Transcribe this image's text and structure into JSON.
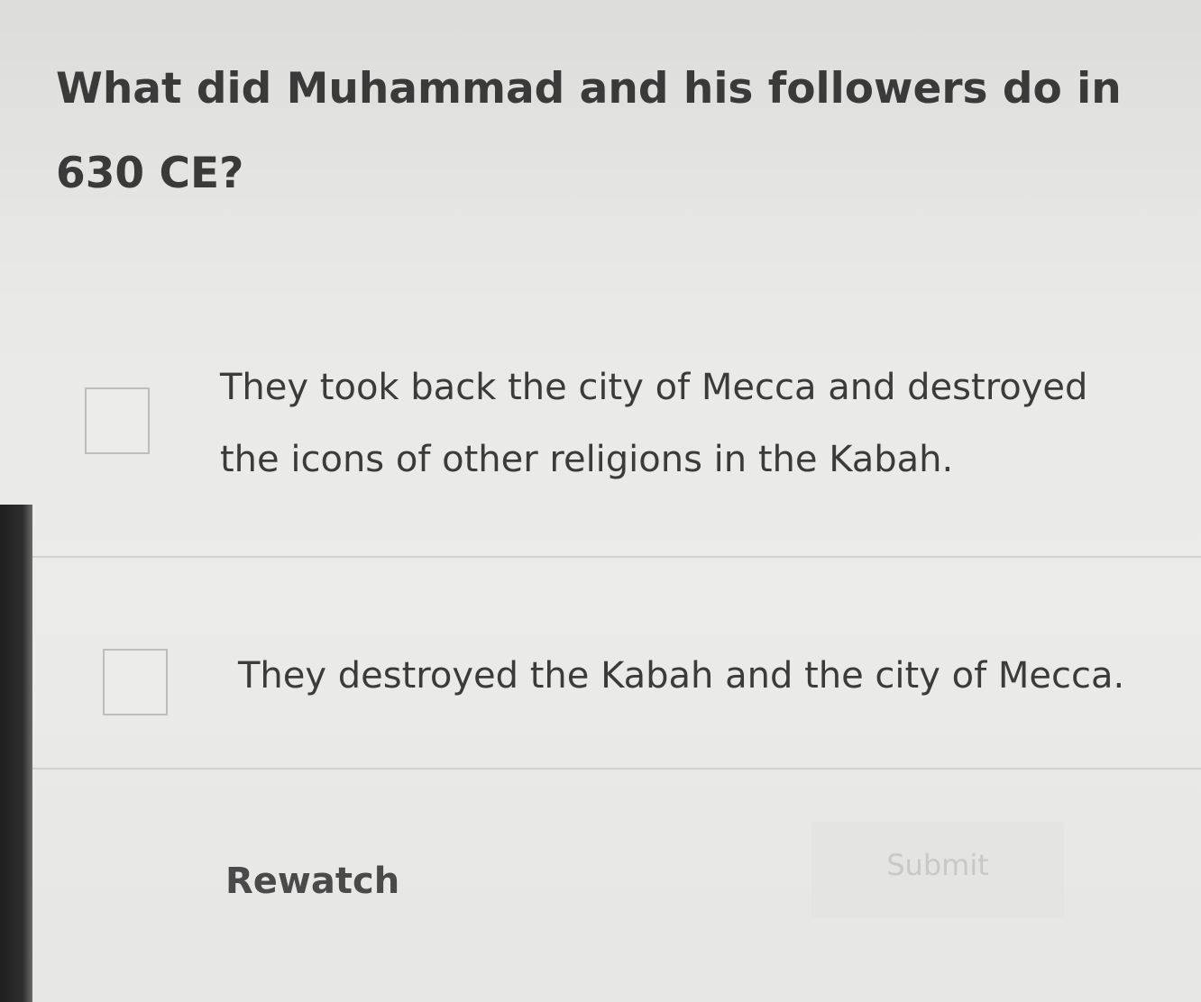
{
  "question": {
    "text": "What did Muhammad and his followers do in 630 CE?"
  },
  "options": [
    {
      "label": "They took back the city of Mecca and destroyed the icons of other religions in the Kabah.",
      "checked": false
    },
    {
      "label": "They destroyed the Kabah and the city of Mecca.",
      "checked": false
    }
  ],
  "actions": {
    "rewatch_label": "Rewatch",
    "submit_label": "Submit",
    "submit_enabled": false
  }
}
